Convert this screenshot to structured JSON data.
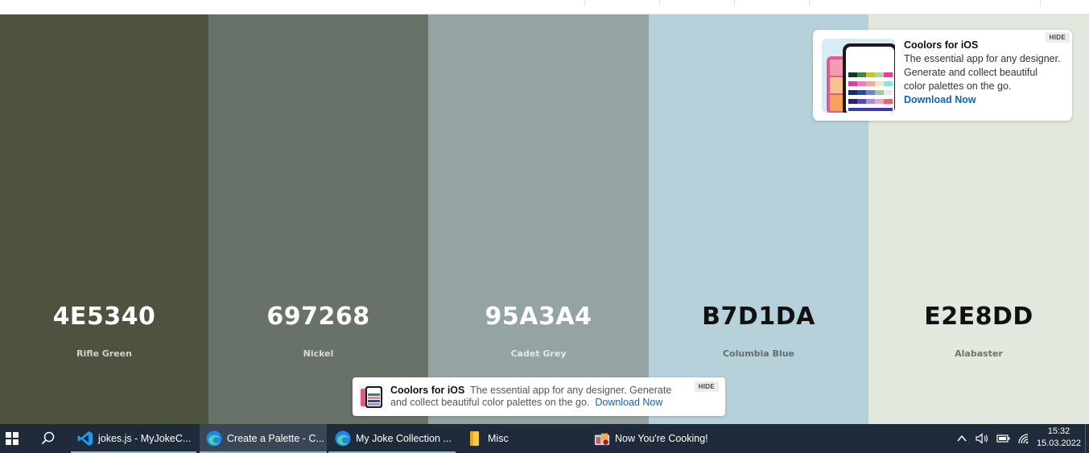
{
  "palette": {
    "swatches": [
      {
        "hex": "4E5340",
        "name": "Rifle Green",
        "color": "#4E5340",
        "text_color": "#ffffff",
        "name_color": "#d0d3c8"
      },
      {
        "hex": "697268",
        "name": "Nickel",
        "color": "#697268",
        "text_color": "#ffffff",
        "name_color": "#d6d9d5"
      },
      {
        "hex": "95A3A4",
        "name": "Cadet Grey",
        "color": "#95A3A4",
        "text_color": "#ffffff",
        "name_color": "#e3e8e8"
      },
      {
        "hex": "B7D1DA",
        "name": "Columbia Blue",
        "color": "#B7D1DA",
        "text_color": "#111111",
        "name_color": "#5f6f74"
      },
      {
        "hex": "E2E8DD",
        "name": "Alabaster",
        "color": "#E2E8DD",
        "text_color": "#111111",
        "name_color": "#6f736c"
      }
    ]
  },
  "ad_card": {
    "title": "Coolors for iOS",
    "line1": "The essential app for any designer.",
    "line2": "Generate and collect beautiful",
    "line3": "color palettes on the go.",
    "link": "Download Now",
    "hide": "HIDE"
  },
  "ad_bottom": {
    "title": "Coolors for iOS",
    "line1": "The essential app for any designer. Generate",
    "line2": "and collect beautiful color palettes on the go.",
    "link": "Download Now",
    "hide": "HIDE"
  },
  "taskbar": {
    "items": [
      {
        "label": "jokes.js - MyJokeC...",
        "icon": "vscode-icon"
      },
      {
        "label": "Create a Palette - C...",
        "icon": "edge-icon"
      },
      {
        "label": "My Joke Collection ...",
        "icon": "edge-icon"
      },
      {
        "label": "Misc",
        "icon": "folder-icon"
      },
      {
        "label": "Now You're Cooking!",
        "icon": "app-icon"
      }
    ],
    "time": "15:32",
    "date": "15.03.2022"
  }
}
